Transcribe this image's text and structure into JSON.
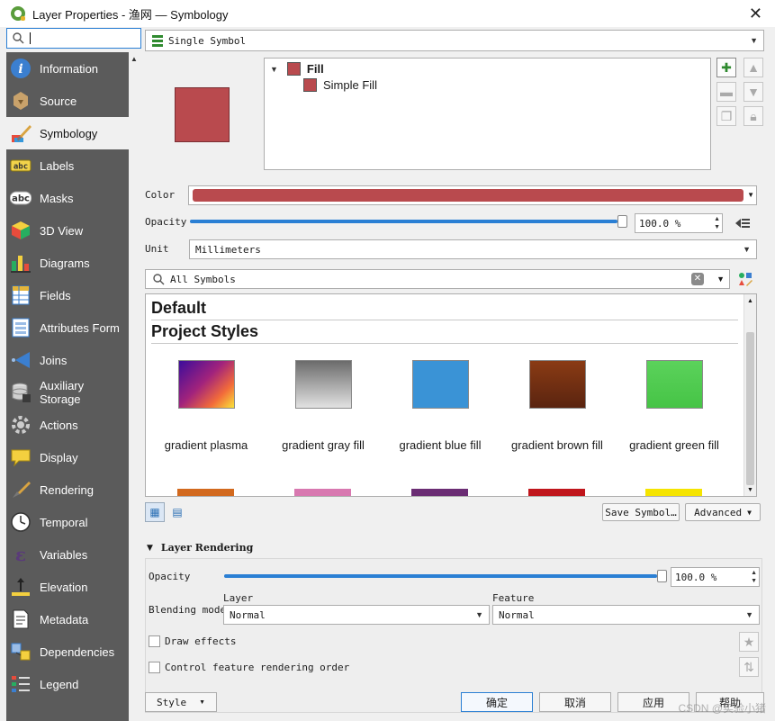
{
  "window": {
    "title": "Layer Properties - 渔网 — Symbology",
    "close_glyph": "✕"
  },
  "sidebar": {
    "search_value": "",
    "items": [
      {
        "label": "Information",
        "icon": "information-icon"
      },
      {
        "label": "Source",
        "icon": "source-icon"
      },
      {
        "label": "Symbology",
        "icon": "symbology-icon",
        "selected": true
      },
      {
        "label": "Labels",
        "icon": "labels-icon"
      },
      {
        "label": "Masks",
        "icon": "masks-icon"
      },
      {
        "label": "3D View",
        "icon": "3d-view-icon"
      },
      {
        "label": "Diagrams",
        "icon": "diagrams-icon"
      },
      {
        "label": "Fields",
        "icon": "fields-icon"
      },
      {
        "label": "Attributes Form",
        "icon": "attributes-form-icon"
      },
      {
        "label": "Joins",
        "icon": "joins-icon"
      },
      {
        "label": "Auxiliary Storage",
        "label_line1": "Auxiliary",
        "label_line2": "Storage",
        "icon": "auxiliary-storage-icon"
      },
      {
        "label": "Actions",
        "icon": "actions-icon"
      },
      {
        "label": "Display",
        "icon": "display-icon"
      },
      {
        "label": "Rendering",
        "icon": "rendering-icon"
      },
      {
        "label": "Temporal",
        "icon": "temporal-icon"
      },
      {
        "label": "Variables",
        "icon": "variables-icon"
      },
      {
        "label": "Elevation",
        "icon": "elevation-icon"
      },
      {
        "label": "Metadata",
        "icon": "metadata-icon"
      },
      {
        "label": "Dependencies",
        "icon": "dependencies-icon"
      },
      {
        "label": "Legend",
        "icon": "legend-icon"
      }
    ]
  },
  "renderer": {
    "selected": "Single Symbol"
  },
  "symbol_tree": {
    "root_label": "Fill",
    "child_label": "Simple Fill",
    "color": "#b94a4e"
  },
  "symbol_props": {
    "color_label": "Color",
    "color_value": "#b94a4e",
    "opacity_label": "Opacity",
    "opacity_value": "100.0 %",
    "opacity_fraction": 1.0,
    "unit_label": "Unit",
    "unit_value": "Millimeters"
  },
  "library": {
    "search_value": "All Symbols",
    "groups": [
      "Default",
      "Project Styles"
    ],
    "symbols": [
      {
        "name": "gradient  plasma",
        "color_a": "#4b0c9b",
        "color_b": "#f9d53a",
        "kind": "plasma"
      },
      {
        "name": "gradient  gray fill",
        "color_a": "#6b6b6b",
        "color_b": "#e2e2e2",
        "kind": "vertical"
      },
      {
        "name": "gradient blue fill",
        "color_a": "#3a93d6",
        "color_b": "#3a93d6",
        "kind": "vertical"
      },
      {
        "name": "gradient brown fill",
        "color_a": "#8a3b14",
        "color_b": "#5a2410",
        "kind": "vertical"
      },
      {
        "name": "gradient green fill",
        "color_a": "#5bd25b",
        "color_b": "#46c446",
        "kind": "vertical"
      }
    ],
    "next_row_colors": [
      "#d2691e",
      "#d878b0",
      "#6b2d74",
      "#c0161c",
      "#f5e400"
    ],
    "save_symbol_label": "Save Symbol…",
    "advanced_label": "Advanced"
  },
  "layer_rendering": {
    "title": "Layer Rendering",
    "opacity_label": "Opacity",
    "opacity_value": "100.0 %",
    "opacity_fraction": 1.0,
    "blending_label": "Blending mode",
    "layer_label": "Layer",
    "layer_value": "Normal",
    "feature_label": "Feature",
    "feature_value": "Normal",
    "draw_effects_label": "Draw effects",
    "draw_effects_checked": false,
    "control_order_label": "Control feature rendering order",
    "control_order_checked": false
  },
  "footer": {
    "style_label": "Style",
    "ok_label": "确定",
    "cancel_label": "取消",
    "apply_label": "应用",
    "help_label": "帮助"
  },
  "watermark": "CSDN @实验小猪"
}
